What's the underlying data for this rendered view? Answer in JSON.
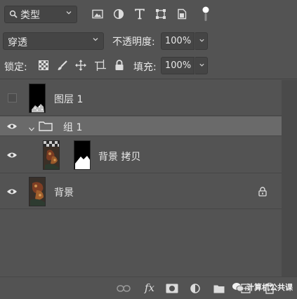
{
  "filter": {
    "kind_label": "类型"
  },
  "blend": {
    "mode": "穿透",
    "opacity_label": "不透明度:",
    "opacity_value": "100%"
  },
  "lock": {
    "label": "锁定:",
    "fill_label": "填充:",
    "fill_value": "100%"
  },
  "layers": [
    {
      "name": "图层 1",
      "visible": false,
      "type": "pixel"
    },
    {
      "name": "组 1",
      "visible": true,
      "type": "group",
      "expanded": true,
      "selected": true
    },
    {
      "name": "背景 拷贝",
      "visible": true,
      "type": "pixel-with-mask",
      "indent": true
    },
    {
      "name": "背景",
      "visible": true,
      "type": "background",
      "locked": true
    }
  ],
  "footer": {
    "fx_label": "fx",
    "watermark": "计算机公共课"
  },
  "icons": {
    "filter": [
      "search-icon",
      "image-filter-icon",
      "adjustment-filter-icon",
      "type-filter-icon",
      "shape-filter-icon",
      "smart-object-filter-icon",
      "filter-toggle-icon"
    ],
    "lock": [
      "lock-transparent-icon",
      "lock-image-icon",
      "lock-position-icon",
      "lock-artboard-icon",
      "lock-all-icon"
    ],
    "footer": [
      "link-layers-icon",
      "layer-style-icon",
      "add-mask-icon",
      "adjustment-layer-icon",
      "new-group-icon",
      "new-layer-icon",
      "delete-layer-icon"
    ]
  },
  "colors": {
    "panel_bg": "#535353",
    "selected_row": "#6a6a6a",
    "field_bg": "#454545"
  }
}
